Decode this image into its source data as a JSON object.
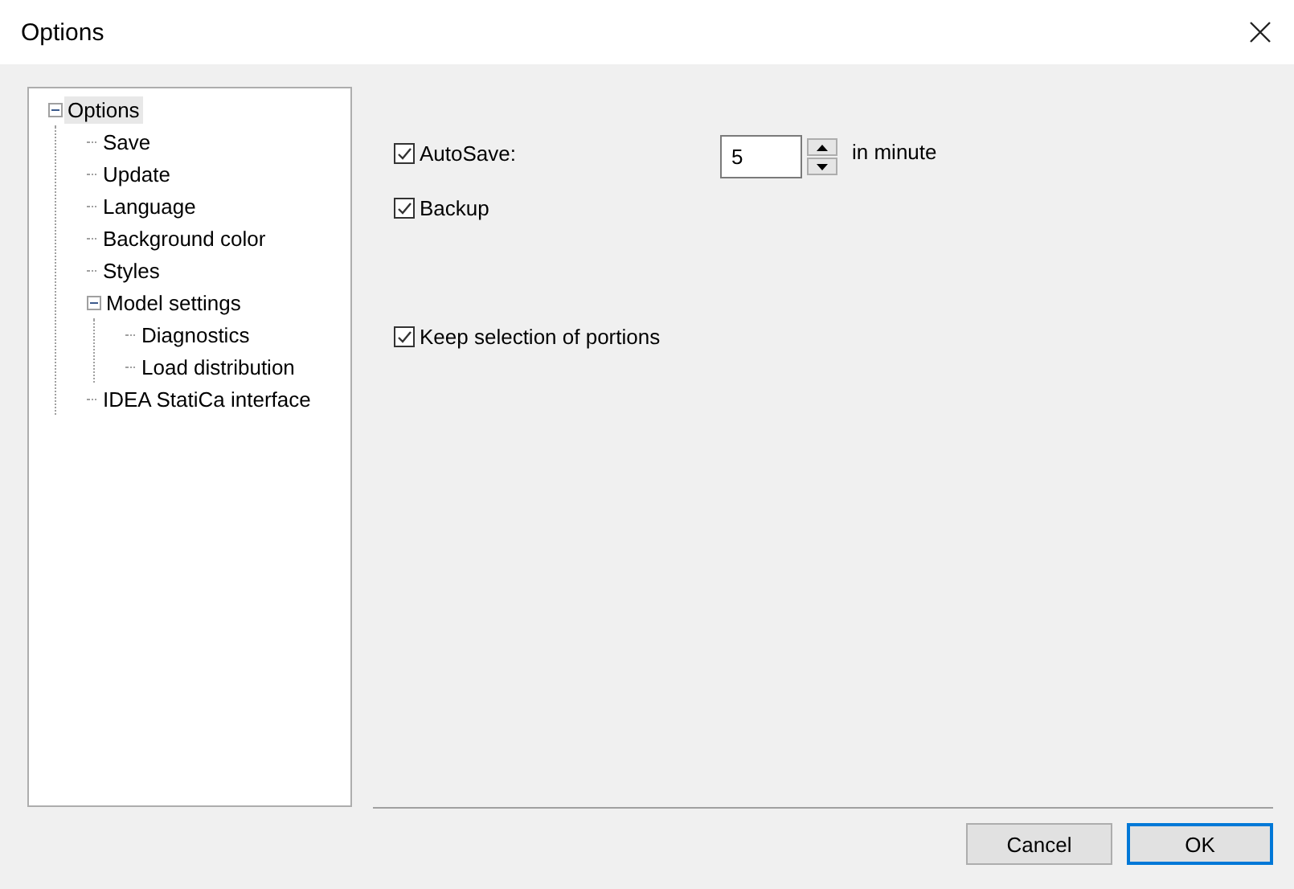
{
  "window": {
    "title": "Options"
  },
  "tree": [
    {
      "label": "Options",
      "selected": true,
      "expanded": true,
      "children": [
        {
          "label": "Save",
          "selected": false
        },
        {
          "label": "Update",
          "selected": false
        },
        {
          "label": "Language",
          "selected": false
        },
        {
          "label": "Background color",
          "selected": false
        },
        {
          "label": "Styles",
          "selected": false
        },
        {
          "label": "Model settings",
          "selected": false,
          "expanded": true,
          "children": [
            {
              "label": "Diagnostics",
              "selected": false
            },
            {
              "label": "Load distribution",
              "selected": false
            }
          ]
        },
        {
          "label": "IDEA StatiCa interface",
          "selected": false
        }
      ]
    }
  ],
  "groups": [
    [
      {
        "kind": "checkbox",
        "label": "AutoSave:",
        "checked": true,
        "field": {
          "value": "5"
        },
        "unit": "in minute"
      },
      {
        "kind": "checkbox",
        "label": "Backup",
        "checked": true
      }
    ],
    [
      {
        "kind": "checkbox",
        "label": "Keep selection of portions",
        "checked": true
      }
    ]
  ],
  "buttons": [
    {
      "label": "Cancel",
      "default": false
    },
    {
      "label": "OK",
      "default": true
    }
  ]
}
